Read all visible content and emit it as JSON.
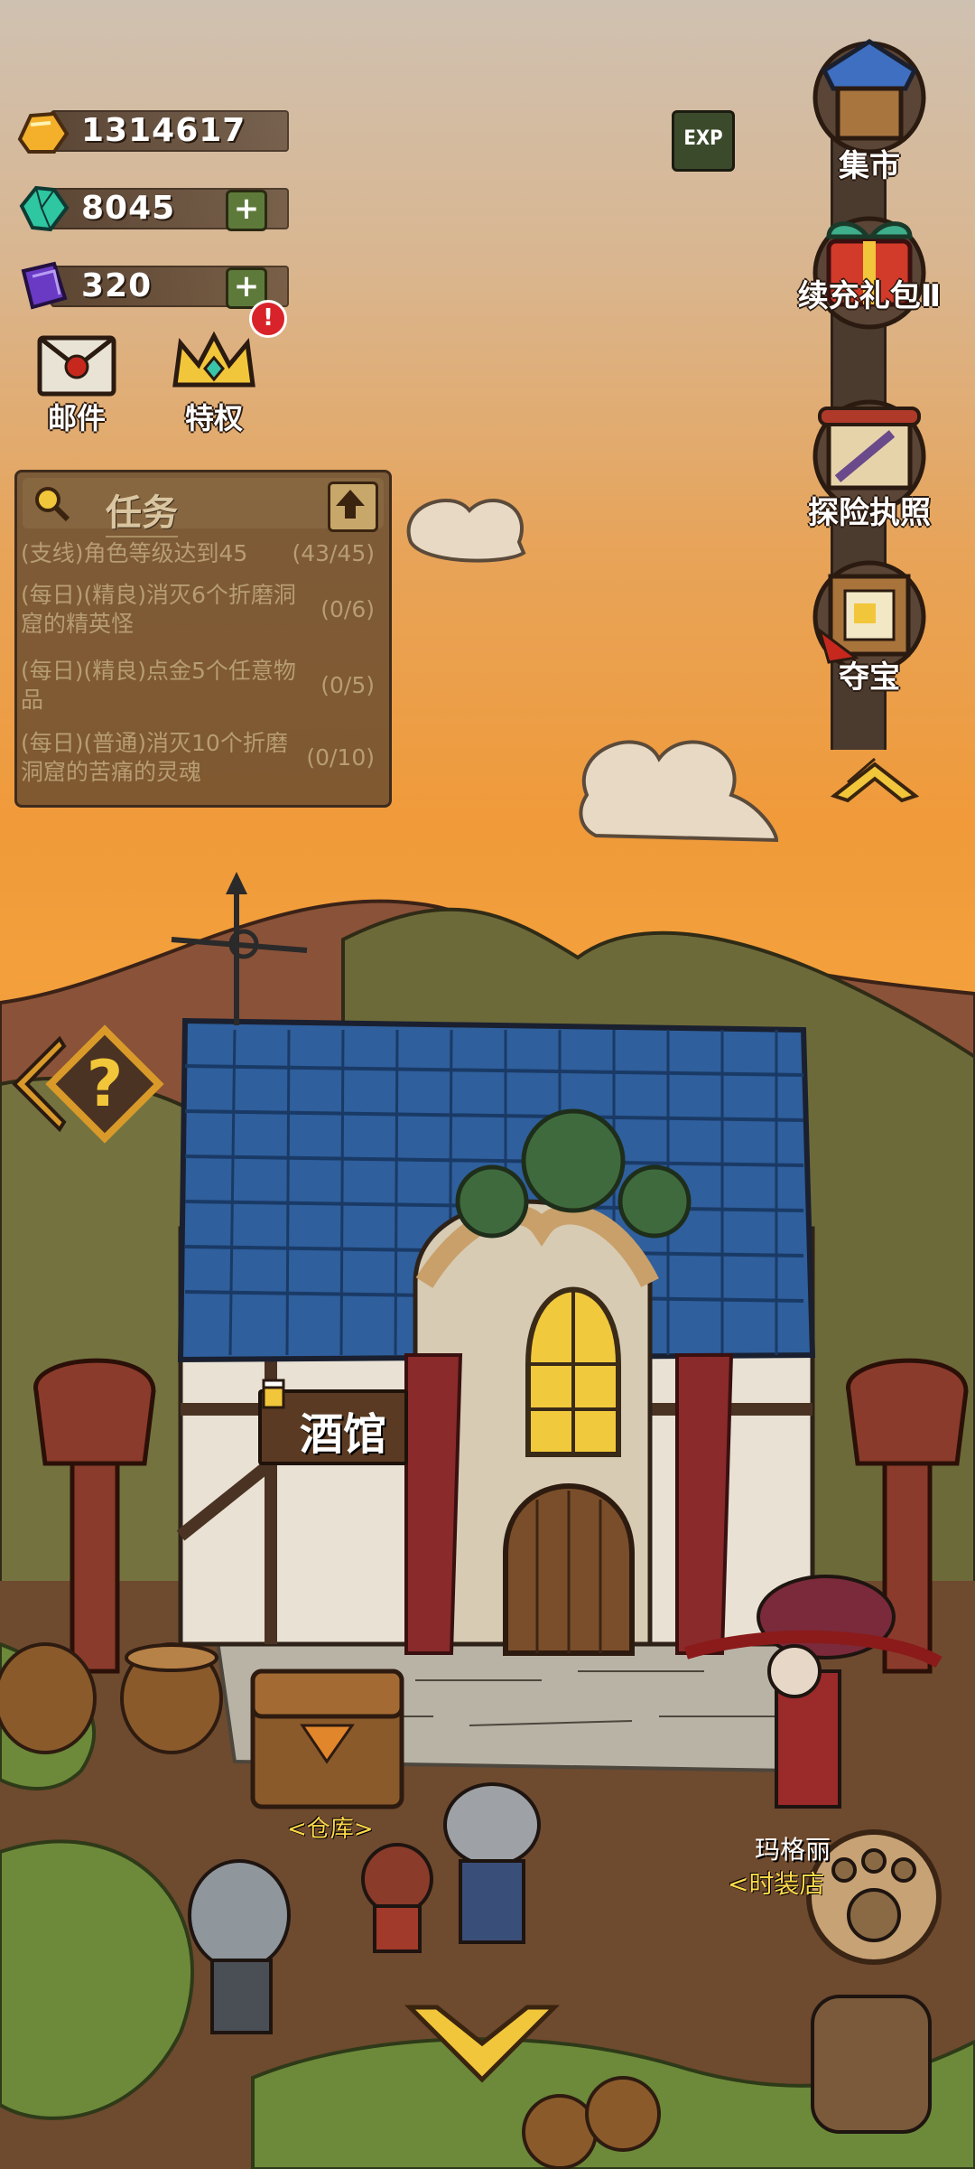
{
  "resources": {
    "gold": "1314617",
    "gems": "8045",
    "crystals": "320"
  },
  "top": {
    "exp_label": "EXP",
    "mail_label": "邮件",
    "privilege_label": "特权"
  },
  "right_menu": {
    "market": "集市",
    "gift": "续充礼包Ⅱ",
    "license": "探险执照",
    "treasure": "夺宝"
  },
  "quest": {
    "title": "任务",
    "items": [
      {
        "text": "(支线)角色等级达到45",
        "progress": "(43/45)"
      },
      {
        "text": "(每日)(精良)消灭6个折磨洞窟的精英怪",
        "progress": "(0/6)"
      },
      {
        "text": "(每日)(精良)点金5个任意物品",
        "progress": "(0/5)"
      },
      {
        "text": "(每日)(普通)消灭10个折磨洞窟的苦痛的灵魂",
        "progress": "(0/10)"
      }
    ]
  },
  "scene": {
    "tavern_sign": "酒馆",
    "warehouse_label": "<仓库>",
    "npc_name": "玛格丽",
    "npc_role": "<时装店"
  }
}
